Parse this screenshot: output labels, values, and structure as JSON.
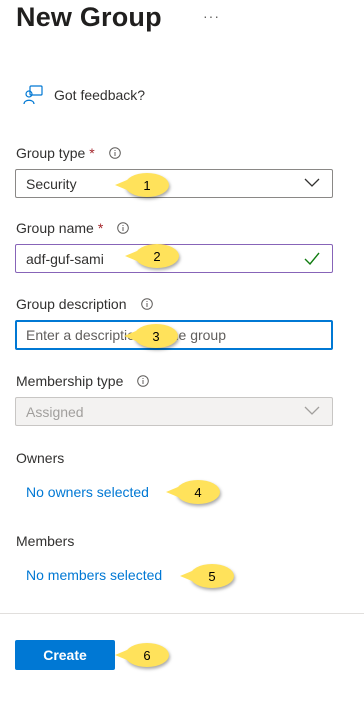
{
  "header": {
    "title": "New Group",
    "more_label": "···"
  },
  "feedback": {
    "label": "Got feedback?"
  },
  "group_type": {
    "label": "Group type",
    "required_mark": "*",
    "value": "Security"
  },
  "group_name": {
    "label": "Group name",
    "required_mark": "*",
    "value": "adf-guf-sami"
  },
  "group_description": {
    "label": "Group description",
    "placeholder": "Enter a description for the group"
  },
  "membership_type": {
    "label": "Membership type",
    "value": "Assigned"
  },
  "owners": {
    "label": "Owners",
    "link": "No owners selected"
  },
  "members": {
    "label": "Members",
    "link": "No members selected"
  },
  "actions": {
    "create_label": "Create"
  },
  "callouts": [
    "1",
    "2",
    "3",
    "4",
    "5",
    "6"
  ],
  "colors": {
    "accent": "#0078d4",
    "required": "#a4262c",
    "callout": "#ffe25b",
    "valid": "#107c10"
  }
}
